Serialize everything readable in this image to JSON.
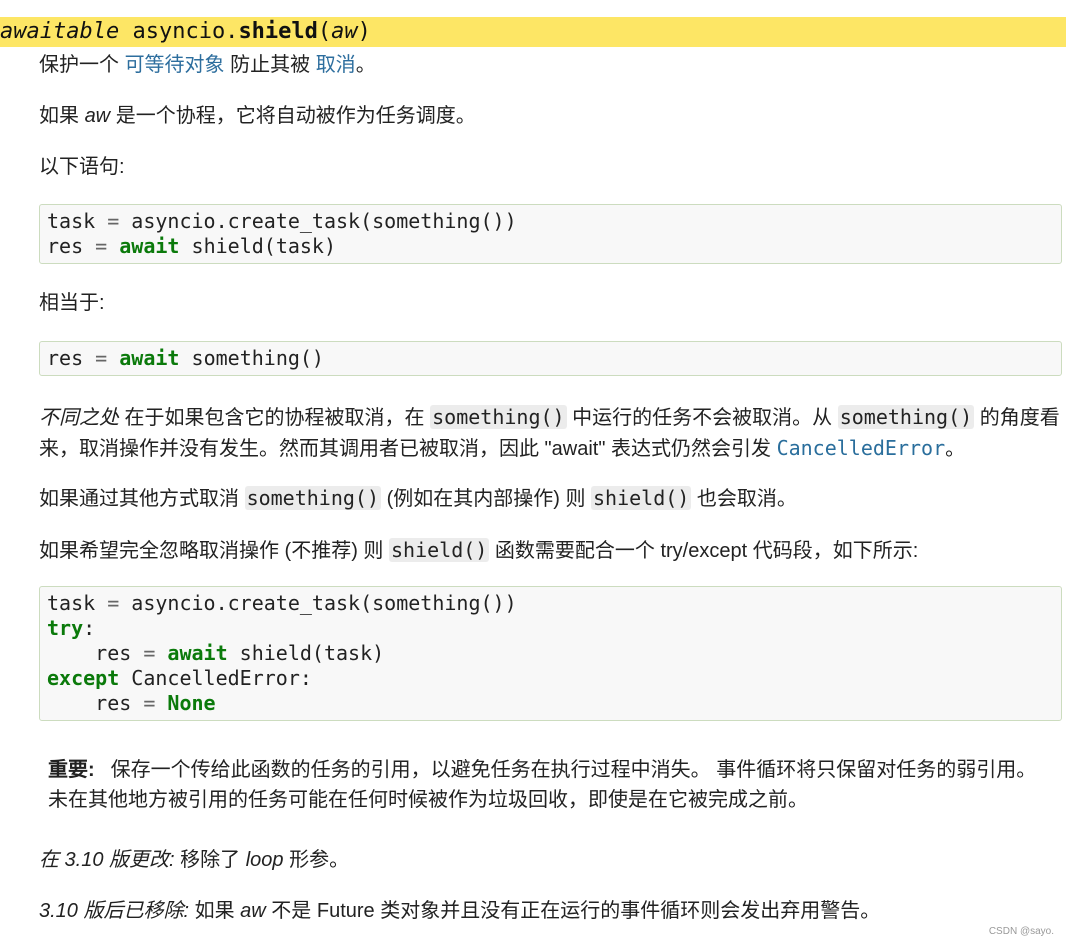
{
  "signature": {
    "prefix": "awaitable",
    "module": "asyncio.",
    "func": "shield",
    "open": "(",
    "param": "aw",
    "close": ")"
  },
  "p1": {
    "t1": "保护一个 ",
    "link1": "可等待对象",
    "t2": " 防止其被 ",
    "link2": "取消",
    "t3": "。"
  },
  "p2": {
    "t1": "如果 ",
    "aw": "aw",
    "t2": " 是一个协程，它将自动被作为任务调度。"
  },
  "p3": {
    "text": "以下语句:"
  },
  "code1": {
    "l1_a": "task ",
    "l1_op": "=",
    "l1_b": " asyncio.create_task(something())",
    "l2_a": "res ",
    "l2_op": "=",
    "l2_sp": " ",
    "l2_kw": "await",
    "l2_b": " shield(task)"
  },
  "p4": {
    "text": "相当于:"
  },
  "code2": {
    "a": "res ",
    "op": "=",
    "sp": " ",
    "kw": "await",
    "b": " something()"
  },
  "p5": {
    "em": "不同之处",
    "t1": " 在于如果包含它的协程被取消，在 ",
    "c1": "something()",
    "t2": " 中运行的任务不会被取消。从 ",
    "c2": "something()",
    "t3": " 的角度看来，取消操作并没有发生。然而其调用者已被取消，因此 \"await\" 表达式仍然会引发 ",
    "link": "CancelledError",
    "t4": "。"
  },
  "p6": {
    "t1": "如果通过其他方式取消 ",
    "c1": "something()",
    "t2": " (例如在其内部操作) 则 ",
    "c2": "shield()",
    "t3": " 也会取消。"
  },
  "p7": {
    "t1": "如果希望完全忽略取消操作 (不推荐) 则 ",
    "c1": "shield()",
    "t2": " 函数需要配合一个 try/except 代码段，如下所示:"
  },
  "code3": {
    "l1_a": "task ",
    "l1_op": "=",
    "l1_b": " asyncio.create_task(something())",
    "l2_kw": "try",
    "l2_b": ":",
    "l3_a": "    res ",
    "l3_op": "=",
    "l3_sp": " ",
    "l3_kw": "await",
    "l3_b": " shield(task)",
    "l4_kw": "except",
    "l4_b": " CancelledError:",
    "l5_a": "    res ",
    "l5_op": "=",
    "l5_sp": " ",
    "l5_kw": "None"
  },
  "note": {
    "label": "重要:",
    "text": "保存一个传给此函数的任务的引用，以避免任务在执行过程中消失。 事件循环将只保留对任务的弱引用。 未在其他地方被引用的任务可能在任何时候被作为垃圾回收，即使是在它被完成之前。"
  },
  "changed": {
    "em": "在 3.10 版更改:",
    "t1": " 移除了 ",
    "loop": "loop",
    "t2": " 形参。"
  },
  "deprecated": {
    "em": "3.10 版后已移除:",
    "t1": " 如果 ",
    "aw": "aw",
    "t2": " 不是 Future 类对象并且没有正在运行的事件循环则会发出弃用警告。"
  },
  "watermark": "CSDN @sayo."
}
